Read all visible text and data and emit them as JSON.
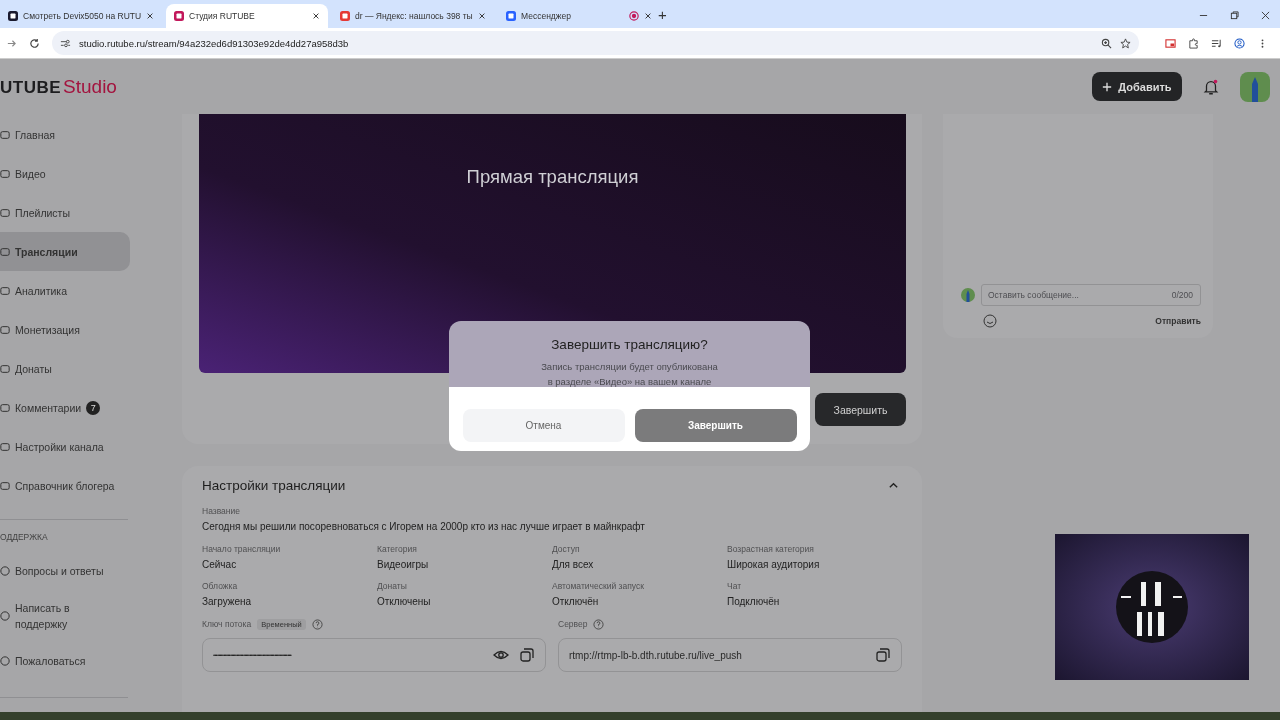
{
  "browser": {
    "tabs": [
      {
        "title": "Смотреть Devix5050 на RUTU",
        "selected": false
      },
      {
        "title": "Студия RUTUBE",
        "selected": true
      },
      {
        "title": "dr — Яндекс: нашлось 398 ты",
        "selected": false
      },
      {
        "title": "Мессенджер",
        "selected": false,
        "recording": true
      }
    ],
    "new_tab": "+",
    "url": "studio.rutube.ru/stream/94a232ed6d91303e92de4dd27a958d3b"
  },
  "header": {
    "logo": {
      "brand": "UTUBE",
      "product": "Studio"
    },
    "add_button": "Добавить",
    "has_unread": true
  },
  "sidebar": {
    "items": [
      {
        "label": "Главная",
        "selected": false
      },
      {
        "label": "Видео",
        "selected": false
      },
      {
        "label": "Плейлисты",
        "selected": false
      },
      {
        "label": "Трансляции",
        "selected": true
      },
      {
        "label": "Аналитика",
        "selected": false
      },
      {
        "label": "Монетизация",
        "selected": false
      },
      {
        "label": "Донаты",
        "selected": false
      },
      {
        "label": "Комментарии",
        "selected": false,
        "badge": "7"
      },
      {
        "label": "Настройки канала",
        "selected": false
      },
      {
        "label": "Справочник блогера",
        "selected": false
      }
    ],
    "support_heading": "ОДДЕРЖКА",
    "support_items": [
      {
        "label": "Вопросы и ответы"
      },
      {
        "label": "Написать в поддержку"
      },
      {
        "label": "Пожаловаться"
      }
    ]
  },
  "stream": {
    "title": "Прямая трансляция",
    "end_button": "Завершить"
  },
  "settings": {
    "title": "Настройки трансляции",
    "expanded": true,
    "name_label": "Название",
    "name_value": "Сегодня мы решили посоревноваться с Игорем на 2000р кто из нас лучше играет в майнкрафт",
    "fields": [
      {
        "label": "Начало трансляции",
        "value": "Сейчас"
      },
      {
        "label": "Категория",
        "value": "Видеоигры"
      },
      {
        "label": "Доступ",
        "value": "Для всех"
      },
      {
        "label": "Возрастная категория",
        "value": "Широкая аудитория"
      },
      {
        "label": "Обложка",
        "value": "Загружена"
      },
      {
        "label": "Донаты",
        "value": "Отключены"
      },
      {
        "label": "Автоматический запуск",
        "value": "Отключён"
      },
      {
        "label": "Чат",
        "value": "Подключён"
      }
    ],
    "stream_key": {
      "label": "Ключ потока",
      "tag": "Временный",
      "value": "••••••••••••••••••••••••••••••••••••••••••••••••••••••••••••"
    },
    "server": {
      "label": "Сервер",
      "value": "rtmp://rtmp-lb-b.dth.rutube.ru/live_push"
    }
  },
  "chat": {
    "placeholder": "Оставить сообщение...",
    "counter": "0/200",
    "send": "Отправить"
  },
  "dialog": {
    "title": "Завершить трансляцию?",
    "text": "Запись трансляции будет опубликована\nв разделе «Видео» на вашем канале",
    "buttons": [
      {
        "label": "Отмена",
        "kind": "secondary"
      },
      {
        "label": "Завершить",
        "kind": "primary"
      }
    ]
  }
}
